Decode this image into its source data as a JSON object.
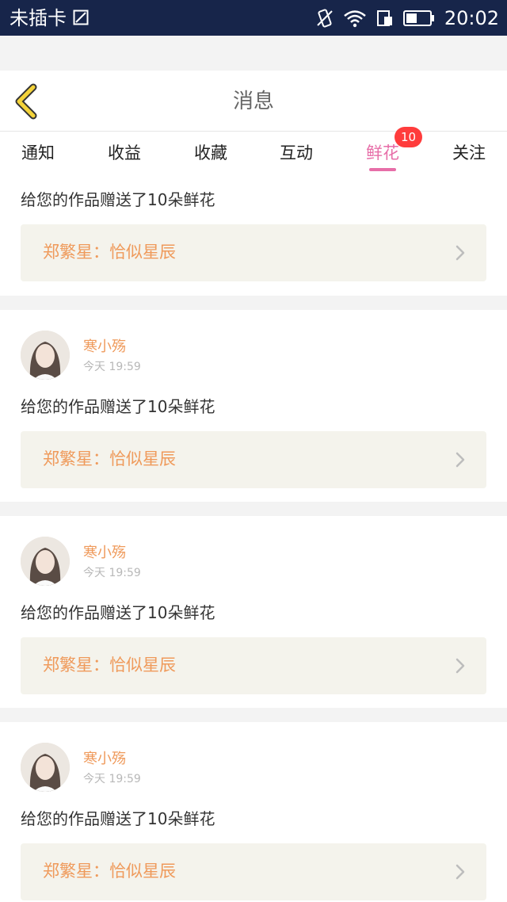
{
  "status_bar": {
    "carrier": "未插卡",
    "time": "20:02",
    "icons": [
      "sim-icon",
      "vibrate-icon",
      "wifi-icon",
      "data-icon",
      "battery-icon"
    ]
  },
  "nav": {
    "back_icon": "chevron-left-icon",
    "title": "消息",
    "accent_color": "#f4d33a"
  },
  "tabs": {
    "items": [
      {
        "label": "通知"
      },
      {
        "label": "收益"
      },
      {
        "label": "收藏"
      },
      {
        "label": "互动"
      },
      {
        "label": "鲜花",
        "badge": "10",
        "active": true
      },
      {
        "label": "关注"
      }
    ],
    "active_color": "#e76ea8",
    "badge_color": "#ff3c3c"
  },
  "messages": [
    {
      "text": "给您的作品赠送了10朵鲜花",
      "work_title": "郑繁星：恰似星辰"
    },
    {
      "username": "寒小殇",
      "time": "今天 19:59",
      "text": "给您的作品赠送了10朵鲜花",
      "work_title": "郑繁星：恰似星辰"
    },
    {
      "username": "寒小殇",
      "time": "今天 19:59",
      "text": "给您的作品赠送了10朵鲜花",
      "work_title": "郑繁星：恰似星辰"
    },
    {
      "username": "寒小殇",
      "time": "今天 19:59",
      "text": "给您的作品赠送了10朵鲜花",
      "work_title": "郑繁星：恰似星辰"
    }
  ],
  "colors": {
    "username": "#ef9a5b",
    "work_title": "#ef9a5b",
    "work_box_bg": "#f4f3ec",
    "status_bar_bg": "#17254a"
  }
}
